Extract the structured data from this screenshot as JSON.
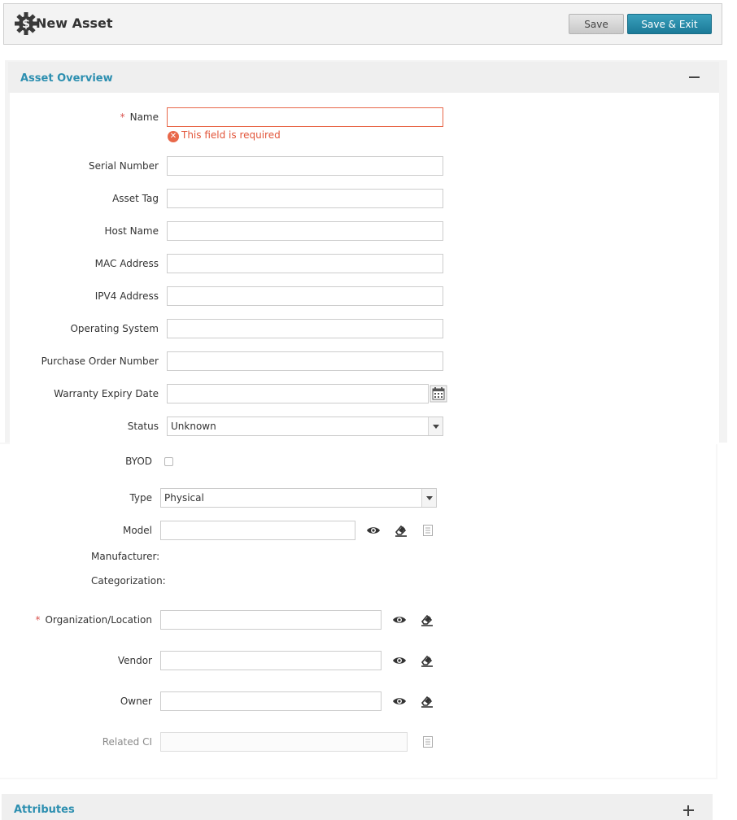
{
  "header": {
    "title": "New Asset",
    "save_label": "Save",
    "save_exit_label": "Save & Exit"
  },
  "section": {
    "title": "Asset Overview"
  },
  "form": {
    "name_label": "Name",
    "name_required": "*",
    "name_error": "This field is required",
    "serial_label": "Serial Number",
    "asset_tag_label": "Asset Tag",
    "host_name_label": "Host Name",
    "mac_label": "MAC Address",
    "ipv4_label": "IPV4 Address",
    "os_label": "Operating System",
    "po_label": "Purchase Order Number",
    "warranty_label": "Warranty Expiry Date",
    "status_label": "Status",
    "status_value": "Unknown",
    "byod_label": "BYOD",
    "type_label": "Type",
    "type_value": "Physical",
    "model_label": "Model",
    "manufacturer_label": "Manufacturer:",
    "categorization_label": "Categorization:",
    "org_label": "Organization/Location",
    "org_required": "*",
    "vendor_label": "Vendor",
    "owner_label": "Owner",
    "related_ci_label": "Related CI"
  },
  "attributes": {
    "title": "Attributes"
  },
  "icons": {
    "header": "gear-dollar-icon",
    "view": "eye-icon",
    "clear": "eraser-icon",
    "details": "document-icon",
    "calendar": "calendar-icon"
  },
  "colors": {
    "accent": "#2d8fb0",
    "primary_button": "#1b7a98",
    "error": "#e2553a"
  }
}
